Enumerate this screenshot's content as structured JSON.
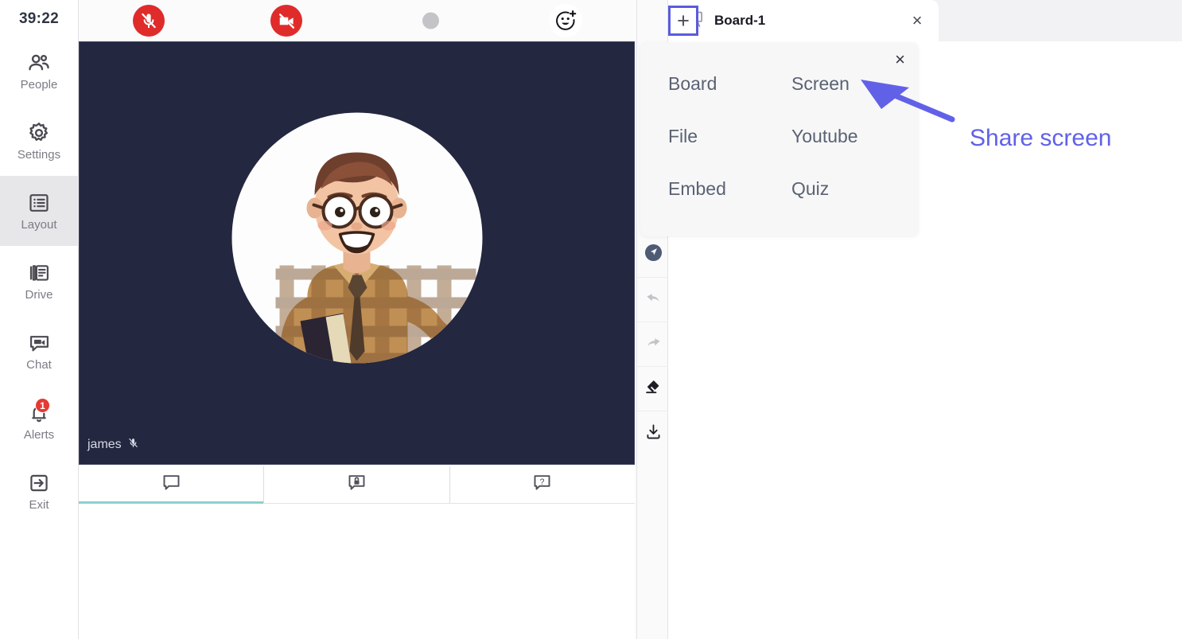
{
  "meeting": {
    "timer": "39:22",
    "participant_name": "james",
    "participant_muted_icon": "mic-muted-icon"
  },
  "sidebar": {
    "items": [
      {
        "label": "People",
        "icon": "people-icon",
        "selected": false,
        "badge": null
      },
      {
        "label": "Settings",
        "icon": "gear-icon",
        "selected": false,
        "badge": null
      },
      {
        "label": "Layout",
        "icon": "layout-icon",
        "selected": true,
        "badge": null
      },
      {
        "label": "Drive",
        "icon": "drive-icon",
        "selected": false,
        "badge": null
      },
      {
        "label": "Chat",
        "icon": "chat-video-icon",
        "selected": false,
        "badge": null
      },
      {
        "label": "Alerts",
        "icon": "bell-icon",
        "selected": false,
        "badge": "1"
      },
      {
        "label": "Exit",
        "icon": "exit-icon",
        "selected": false,
        "badge": null
      }
    ]
  },
  "top_toolbar": {
    "mic_button": {
      "icon": "mic-muted-icon",
      "state": "muted",
      "color": "#e02b2b"
    },
    "camera_button": {
      "icon": "camera-off-icon",
      "state": "off",
      "color": "#e02b2b"
    },
    "record_button": {
      "icon": "record-dot-icon",
      "state": "idle",
      "color": "#c4c4c8"
    },
    "reaction_button": {
      "icon": "emoji-add-icon",
      "state": "default"
    }
  },
  "chat_tabs": [
    {
      "icon": "chat-bubble-icon",
      "name": "public-chat",
      "active": true
    },
    {
      "icon": "private-chat-lock-icon",
      "name": "private-chat",
      "active": false
    },
    {
      "icon": "question-bubble-icon",
      "name": "qa-chat",
      "active": false
    }
  ],
  "tool_rail": [
    {
      "icon": "pointer-icon",
      "name": "pointer-tool",
      "active": true
    },
    {
      "icon": "undo-icon",
      "name": "undo-tool",
      "active": false
    },
    {
      "icon": "redo-icon",
      "name": "redo-tool",
      "active": false
    },
    {
      "icon": "eraser-icon",
      "name": "eraser-tool",
      "active": false
    },
    {
      "icon": "download-icon",
      "name": "download-tool",
      "active": false
    }
  ],
  "board": {
    "tab_title": "Board-1",
    "tab_icon": "easel-board-icon",
    "close_glyph": "×",
    "add_glyph": "+",
    "add_button_highlight_color": "#5b5bdd"
  },
  "popup_menu": {
    "close_glyph": "×",
    "items": [
      {
        "label": "Board"
      },
      {
        "label": "Screen"
      },
      {
        "label": "File"
      },
      {
        "label": "Youtube"
      },
      {
        "label": "Embed"
      },
      {
        "label": "Quiz"
      }
    ]
  },
  "annotation": {
    "text": "Share screen",
    "color": "#6161e8"
  }
}
